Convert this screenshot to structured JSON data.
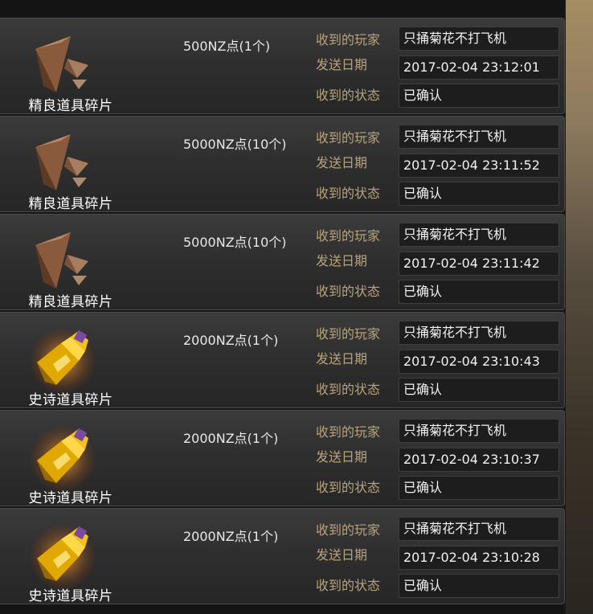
{
  "labels": {
    "player": "收到的玩家",
    "date": "发送日期",
    "status": "收到的状态"
  },
  "rows": [
    {
      "name": "精良道具碎片",
      "reward": "500NZ点(1个)",
      "player": "只捅菊花不打飞机",
      "date": "2017-02-04 23:12:01",
      "status": "已确认",
      "icon": "brown-shard-icon"
    },
    {
      "name": "精良道具碎片",
      "reward": "5000NZ点(10个)",
      "player": "只捅菊花不打飞机",
      "date": "2017-02-04 23:11:52",
      "status": "已确认",
      "icon": "brown-shard-icon"
    },
    {
      "name": "精良道具碎片",
      "reward": "5000NZ点(10个)",
      "player": "只捅菊花不打飞机",
      "date": "2017-02-04 23:11:42",
      "status": "已确认",
      "icon": "brown-shard-icon"
    },
    {
      "name": "史诗道具碎片",
      "reward": "2000NZ点(1个)",
      "player": "只捅菊花不打飞机",
      "date": "2017-02-04 23:10:43",
      "status": "已确认",
      "icon": "gold-shard-icon"
    },
    {
      "name": "史诗道具碎片",
      "reward": "2000NZ点(1个)",
      "player": "只捅菊花不打飞机",
      "date": "2017-02-04 23:10:37",
      "status": "已确认",
      "icon": "gold-shard-icon"
    },
    {
      "name": "史诗道具碎片",
      "reward": "2000NZ点(1个)",
      "player": "只捅菊花不打飞机",
      "date": "2017-02-04 23:10:28",
      "status": "已确认",
      "icon": "gold-shard-icon"
    }
  ]
}
